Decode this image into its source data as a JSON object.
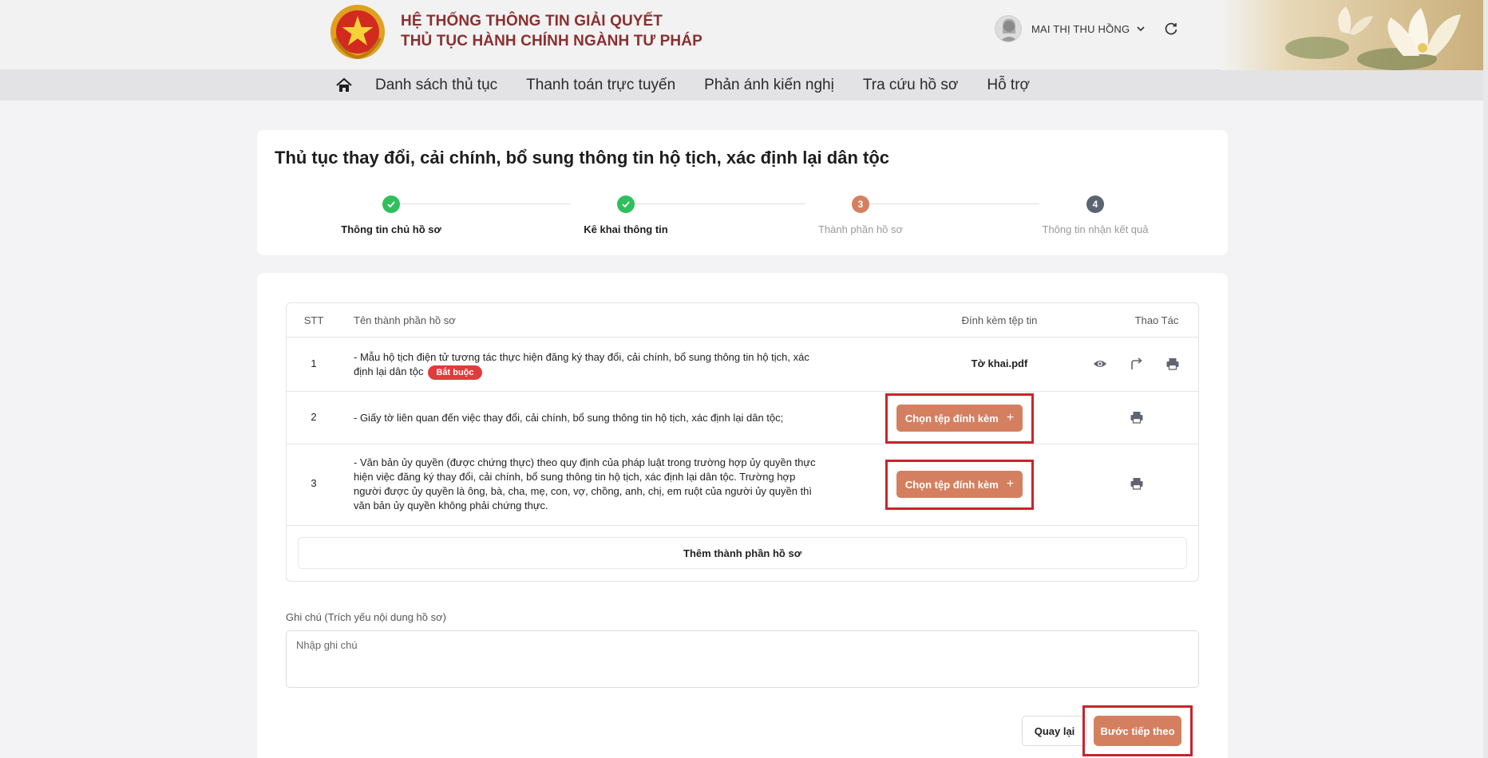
{
  "header": {
    "title_line1": "HỆ THỐNG THÔNG TIN GIẢI QUYẾT",
    "title_line2": "THỦ TỤC HÀNH CHÍNH NGÀNH TƯ PHÁP",
    "user_name": "MAI THỊ THU HỒNG"
  },
  "nav": {
    "items": [
      "Danh sách thủ tục",
      "Thanh toán trực tuyến",
      "Phản ánh kiến nghị",
      "Tra cứu hồ sơ",
      "Hỗ trợ"
    ]
  },
  "procedure": {
    "title": "Thủ tục thay đổi, cải chính, bổ sung thông tin hộ tịch, xác định lại dân tộc",
    "steps": [
      {
        "label": "Thông tin chủ hồ sơ",
        "state": "done",
        "marker": ""
      },
      {
        "label": "Kê khai thông tin",
        "state": "done",
        "marker": ""
      },
      {
        "label": "Thành phần hồ sơ",
        "state": "active",
        "marker": "3"
      },
      {
        "label": "Thông tin nhận kết quả",
        "state": "pending",
        "marker": "4"
      }
    ]
  },
  "table": {
    "headers": {
      "stt": "STT",
      "name": "Tên thành phần hồ sơ",
      "attach": "Đính kèm tệp tin",
      "actions": "Thao Tác"
    },
    "rows": [
      {
        "stt": "1",
        "name": "- Mẫu hộ tịch điện tử tương tác thực hiện đăng ký thay đổi, cải chính, bổ sung thông tin hộ tịch, xác định lại dân tộc",
        "badge": "Bắt buộc",
        "file": "Tờ khai.pdf"
      },
      {
        "stt": "2",
        "name": "- Giấy tờ liên quan đến việc thay đổi, cải chính, bổ sung thông tin hộ tịch, xác định lại dân tộc;",
        "attach_label": "Chọn tệp đính kèm"
      },
      {
        "stt": "3",
        "name": "- Văn bản ủy quyền (được chứng thực) theo quy định của pháp luật trong trường hợp ủy quyền thực hiện việc đăng ký thay đổi, cải chính, bổ sung thông tin hộ tịch, xác định lại dân tộc. Trường hợp người được ủy quyền là ông, bà, cha, mẹ, con, vợ, chồng, anh, chị, em ruột của người ủy quyền thì văn bản ủy quyền không phải chứng thực.",
        "attach_label": "Chọn tệp đính kèm"
      }
    ],
    "add_label": "Thêm thành phần hồ sơ"
  },
  "note": {
    "label": "Ghi chú (Trích yếu nội dung hồ sơ)",
    "placeholder": "Nhập ghi chú",
    "value": ""
  },
  "buttons": {
    "back": "Quay lại",
    "next": "Bước tiếp theo"
  },
  "colors": {
    "accent": "#d48060",
    "done": "#2fbf5d",
    "pending": "#5b6572",
    "title": "#8b2f2f",
    "highlight": "#c8242b"
  }
}
